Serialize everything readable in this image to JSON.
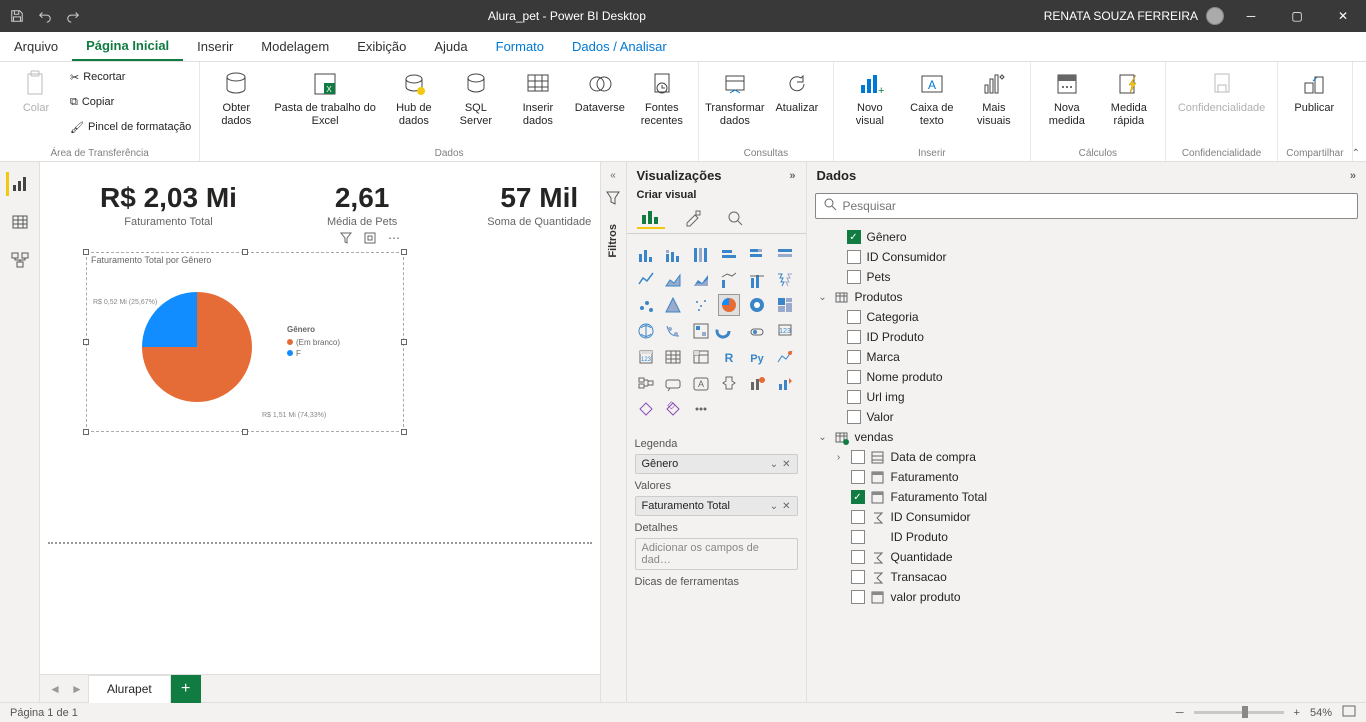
{
  "title": "Alura_pet - Power BI Desktop",
  "user": "RENATA SOUZA FERREIRA",
  "tabs": [
    "Arquivo",
    "Página Inicial",
    "Inserir",
    "Modelagem",
    "Exibição",
    "Ajuda",
    "Formato",
    "Dados / Analisar"
  ],
  "activeTab": 1,
  "ribbon": {
    "clipboard": {
      "paste": "Colar",
      "cut": "Recortar",
      "copy": "Copiar",
      "painter": "Pincel de formatação",
      "label": "Área de Transferência"
    },
    "data": {
      "get": "Obter\ndados",
      "excel": "Pasta de trabalho do\nExcel",
      "hub": "Hub de\ndados",
      "sql": "SQL\nServer",
      "enter": "Inserir\ndados",
      "dataverse": "Dataverse",
      "recent": "Fontes\nrecentes",
      "label": "Dados"
    },
    "queries": {
      "transform": "Transformar\ndados",
      "refresh": "Atualizar",
      "label": "Consultas"
    },
    "insert": {
      "visual": "Novo\nvisual",
      "text": "Caixa de\ntexto",
      "more": "Mais\nvisuais",
      "label": "Inserir"
    },
    "calc": {
      "measure": "Nova\nmedida",
      "quick": "Medida\nrápida",
      "label": "Cálculos"
    },
    "sens": {
      "btn": "Confidencialidade",
      "label": "Confidencialidade"
    },
    "share": {
      "publish": "Publicar",
      "label": "Compartilhar"
    }
  },
  "cards": [
    {
      "value": "R$ 2,03 Mi",
      "label": "Faturamento Total"
    },
    {
      "value": "2,61",
      "label": "Média de Pets"
    },
    {
      "value": "57 Mil",
      "label": "Soma de Quantidade"
    }
  ],
  "pie": {
    "title": "Faturamento Total por Gênero",
    "legend_title": "Gênero",
    "legend": [
      {
        "label": "(Em branco)",
        "color": "#e66c37"
      },
      {
        "label": "F",
        "color": "#118dff"
      }
    ],
    "datalabels": [
      "R$ 0,52 Mi (25,67%)",
      "R$ 1,51 Mi (74,33%)"
    ]
  },
  "chart_data": {
    "type": "pie",
    "title": "Faturamento Total por Gênero",
    "series_label": "Gênero",
    "slices": [
      {
        "category": "(Em branco)",
        "value": 1510000,
        "share": 74.33,
        "display": "R$ 1,51 Mi",
        "color": "#e66c37"
      },
      {
        "category": "F",
        "value": 520000,
        "share": 25.67,
        "display": "R$ 0,52 Mi",
        "color": "#118dff"
      }
    ]
  },
  "vizPane": {
    "title": "Visualizações",
    "subtitle": "Criar visual",
    "wells": {
      "legend": {
        "label": "Legenda",
        "field": "Gênero"
      },
      "values": {
        "label": "Valores",
        "field": "Faturamento Total"
      },
      "details": {
        "label": "Detalhes",
        "placeholder": "Adicionar os campos de dad…"
      },
      "tooltips": {
        "label": "Dicas de ferramentas"
      }
    }
  },
  "dataPane": {
    "title": "Dados",
    "search_placeholder": "Pesquisar",
    "fields": {
      "loose": [
        {
          "name": "Gênero",
          "checked": true
        },
        {
          "name": "ID Consumidor",
          "checked": false
        },
        {
          "name": "Pets",
          "checked": false
        }
      ],
      "produtos": {
        "label": "Produtos",
        "items": [
          {
            "name": "Categoria"
          },
          {
            "name": "ID Produto"
          },
          {
            "name": "Marca"
          },
          {
            "name": "Nome produto"
          },
          {
            "name": "Url img"
          },
          {
            "name": "Valor"
          }
        ]
      },
      "vendas": {
        "label": "vendas",
        "items": [
          {
            "name": "Data de compra",
            "icon": "hier",
            "expandable": true
          },
          {
            "name": "Faturamento",
            "icon": "calc"
          },
          {
            "name": "Faturamento Total",
            "icon": "calc",
            "checked": true
          },
          {
            "name": "ID Consumidor",
            "icon": "sum"
          },
          {
            "name": "ID Produto"
          },
          {
            "name": "Quantidade",
            "icon": "sum"
          },
          {
            "name": "Transacao",
            "icon": "sum"
          },
          {
            "name": "valor produto",
            "icon": "calc"
          }
        ]
      }
    }
  },
  "sheet": "Alurapet",
  "status": {
    "page": "Página 1 de 1",
    "zoom": "54%"
  },
  "filters_label": "Filtros"
}
